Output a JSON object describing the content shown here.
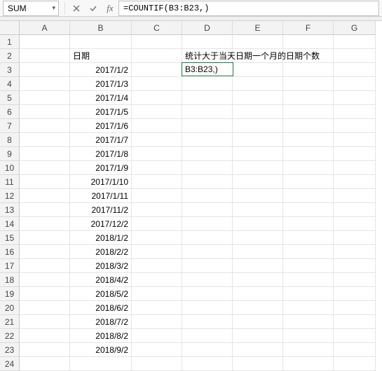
{
  "nameBox": "SUM",
  "formula": "=COUNTIF(B3:B23,)",
  "columns": [
    "A",
    "B",
    "C",
    "D",
    "E",
    "F",
    "G"
  ],
  "rowCount": 24,
  "cells": {
    "B2": "日期",
    "D2": "统计大于当天日期一个月的日期个数",
    "D3": "B3:B23,)"
  },
  "chart_data": {
    "type": "table",
    "title": "日期",
    "column_b_dates": [
      "2017/1/2",
      "2017/1/3",
      "2017/1/4",
      "2017/1/5",
      "2017/1/6",
      "2017/1/7",
      "2017/1/8",
      "2017/1/9",
      "2017/1/10",
      "2017/1/11",
      "2017/11/2",
      "2017/12/2",
      "2018/1/2",
      "2018/2/2",
      "2018/3/2",
      "2018/4/2",
      "2018/5/2",
      "2018/6/2",
      "2018/7/2",
      "2018/8/2",
      "2018/9/2"
    ]
  }
}
